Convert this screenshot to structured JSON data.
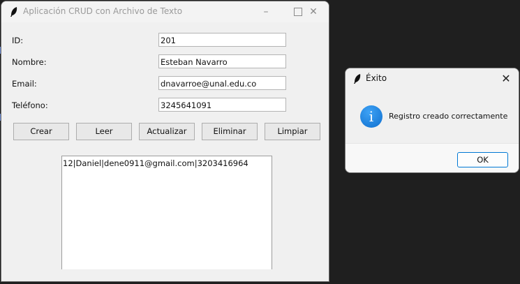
{
  "main_window": {
    "title": "Aplicación CRUD con Archivo de Texto",
    "icon": "feather-icon",
    "controls": {
      "minimize": "–",
      "close": "✕"
    }
  },
  "form": {
    "fields": [
      {
        "label": "ID:",
        "value": "201"
      },
      {
        "label": "Nombre:",
        "value": "Esteban Navarro"
      },
      {
        "label": "Email:",
        "value": "dnavarroe@unal.edu.co"
      },
      {
        "label": "Teléfono:",
        "value": "3245641091"
      }
    ]
  },
  "buttons": {
    "crear": "Crear",
    "leer": "Leer",
    "actualizar": "Actualizar",
    "eliminar": "Eliminar",
    "limpiar": "Limpiar"
  },
  "output": {
    "text": "12|Daniel|dene0911@gmail.com|3203416964"
  },
  "dialog": {
    "title": "Éxito",
    "icon": "info-icon",
    "message": "Registro creado correctamente",
    "ok_label": "OK",
    "close": "✕",
    "info_glyph": "i"
  },
  "colors": {
    "desktop": "#1f1f1f",
    "window": "#f0f0f0",
    "info_blue": "#1a7fe0",
    "ok_border": "#0078d4"
  }
}
